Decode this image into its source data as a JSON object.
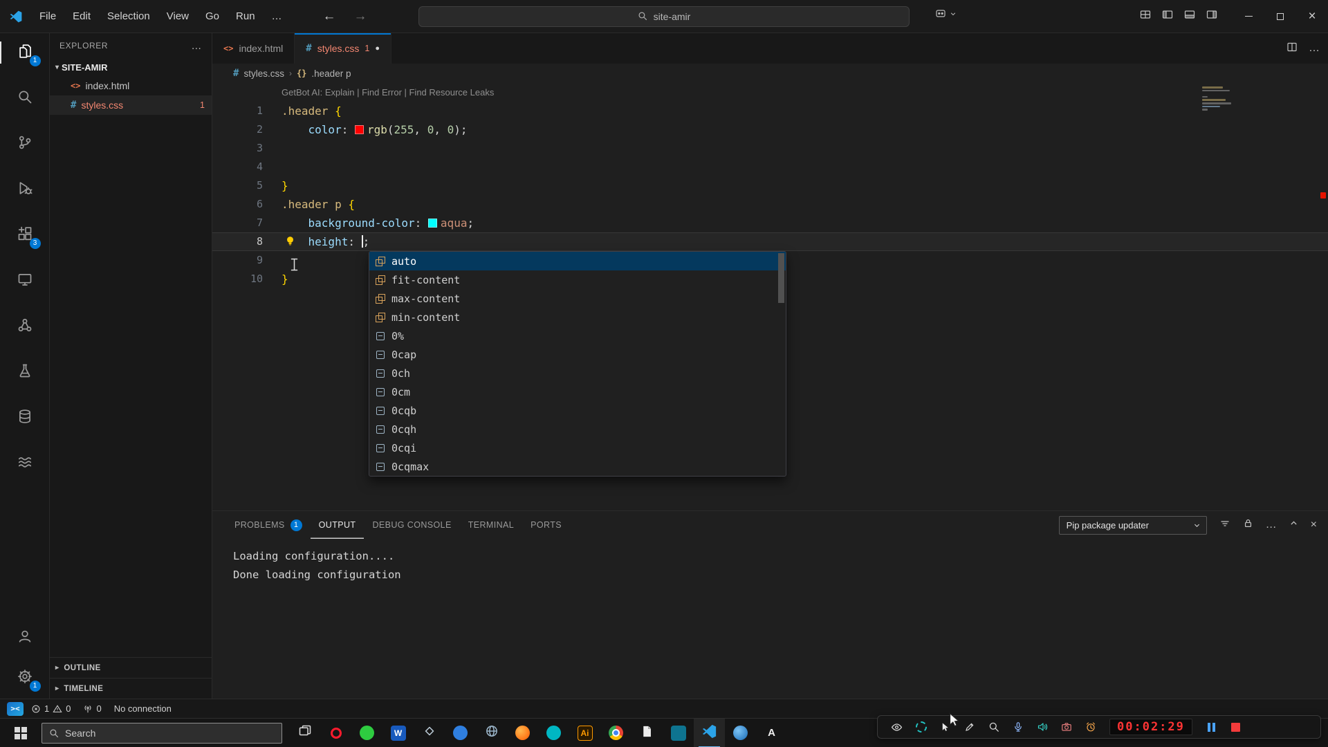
{
  "colors": {
    "accent": "#0078d4",
    "error": "#f14c4c",
    "selection": "#04395e",
    "swatch_red": "#ff0000",
    "swatch_aqua": "#00ffff"
  },
  "title_bar": {
    "menus": [
      "File",
      "Edit",
      "Selection",
      "View",
      "Go",
      "Run"
    ],
    "more_label": "…",
    "search_value": "site-amir"
  },
  "activity_bar": {
    "items": [
      {
        "id": "explorer",
        "active": true,
        "badge": "1"
      },
      {
        "id": "search"
      },
      {
        "id": "source-control"
      },
      {
        "id": "run-debug"
      },
      {
        "id": "extensions",
        "badge": "3"
      },
      {
        "id": "remote-monitor"
      },
      {
        "id": "organization"
      },
      {
        "id": "testing"
      },
      {
        "id": "database"
      },
      {
        "id": "layers"
      }
    ],
    "bottom": [
      {
        "id": "account"
      },
      {
        "id": "settings",
        "badge": "1"
      }
    ]
  },
  "sidebar": {
    "title": "EXPLORER",
    "folder": "SITE-AMIR",
    "files": [
      {
        "name": "index.html",
        "icon": "html"
      },
      {
        "name": "styles.css",
        "icon": "css",
        "active": true,
        "error_badge": "1"
      }
    ],
    "sections": [
      "OUTLINE",
      "TIMELINE"
    ]
  },
  "tabs": [
    {
      "label": "index.html",
      "icon": "html"
    },
    {
      "label": "styles.css",
      "icon": "css",
      "active": true,
      "error_badge": "1",
      "modified": true
    }
  ],
  "breadcrumb": {
    "file": "styles.css",
    "symbol": ".header p"
  },
  "editor": {
    "codelens": "GetBot AI: Explain | Find Error | Find Resource Leaks",
    "lines": [
      {
        "n": "1",
        "tokens": [
          {
            "t": ".header",
            "c": "sel"
          },
          {
            "t": " ",
            "c": "pun"
          },
          {
            "t": "{",
            "c": "brace"
          }
        ]
      },
      {
        "n": "2",
        "tokens": [
          {
            "t": "    ",
            "c": "pun"
          },
          {
            "t": "color",
            "c": "prop"
          },
          {
            "t": ": ",
            "c": "pun"
          },
          {
            "swatch": "#ff0000"
          },
          {
            "t": "rgb",
            "c": "fn"
          },
          {
            "t": "(",
            "c": "pun"
          },
          {
            "t": "255",
            "c": "num"
          },
          {
            "t": ", ",
            "c": "pun"
          },
          {
            "t": "0",
            "c": "num"
          },
          {
            "t": ", ",
            "c": "pun"
          },
          {
            "t": "0",
            "c": "num"
          },
          {
            "t": ")",
            "c": "pun"
          },
          {
            "t": ";",
            "c": "pun"
          }
        ]
      },
      {
        "n": "3",
        "tokens": []
      },
      {
        "n": "4",
        "tokens": []
      },
      {
        "n": "5",
        "tokens": [
          {
            "t": "}",
            "c": "brace"
          }
        ]
      },
      {
        "n": "6",
        "tokens": [
          {
            "t": ".header",
            "c": "sel"
          },
          {
            "t": " ",
            "c": "pun"
          },
          {
            "t": "p",
            "c": "sel"
          },
          {
            "t": " ",
            "c": "pun"
          },
          {
            "t": "{",
            "c": "brace"
          }
        ]
      },
      {
        "n": "7",
        "tokens": [
          {
            "t": "    ",
            "c": "pun"
          },
          {
            "t": "background-color",
            "c": "prop"
          },
          {
            "t": ": ",
            "c": "pun"
          },
          {
            "swatch": "#00ffff"
          },
          {
            "t": "aqua",
            "c": "val"
          },
          {
            "t": ";",
            "c": "pun"
          }
        ]
      },
      {
        "n": "8",
        "current": true,
        "tokens": [
          {
            "t": "    ",
            "c": "pun"
          },
          {
            "t": "height",
            "c": "prop"
          },
          {
            "t": ": ",
            "c": "pun"
          },
          {
            "caret": true
          },
          {
            "t": ";",
            "c": "pun"
          }
        ]
      },
      {
        "n": "9",
        "tokens": []
      },
      {
        "n": "10",
        "tokens": [
          {
            "t": "}",
            "c": "brace"
          }
        ]
      }
    ],
    "suggest": [
      {
        "label": "auto",
        "kind": "value",
        "selected": true
      },
      {
        "label": "fit-content",
        "kind": "value"
      },
      {
        "label": "max-content",
        "kind": "value"
      },
      {
        "label": "min-content",
        "kind": "value"
      },
      {
        "label": "0%",
        "kind": "unit"
      },
      {
        "label": "0cap",
        "kind": "unit"
      },
      {
        "label": "0ch",
        "kind": "unit"
      },
      {
        "label": "0cm",
        "kind": "unit"
      },
      {
        "label": "0cqb",
        "kind": "unit"
      },
      {
        "label": "0cqh",
        "kind": "unit"
      },
      {
        "label": "0cqi",
        "kind": "unit"
      },
      {
        "label": "0cqmax",
        "kind": "unit"
      }
    ]
  },
  "panel": {
    "tabs": [
      {
        "label": "PROBLEMS",
        "badge": "1"
      },
      {
        "label": "OUTPUT",
        "active": true
      },
      {
        "label": "DEBUG CONSOLE"
      },
      {
        "label": "TERMINAL"
      },
      {
        "label": "PORTS"
      }
    ],
    "dropdown_value": "Pip package updater",
    "output_lines": [
      "Loading configuration....",
      "Done loading configuration"
    ]
  },
  "status_bar": {
    "errors": "1",
    "warnings": "0",
    "ports": "0",
    "message": "No connection"
  },
  "taskbar": {
    "search_placeholder": "Search",
    "apps": [
      {
        "id": "task-view"
      },
      {
        "id": "browser-red"
      },
      {
        "id": "app-green"
      },
      {
        "id": "word",
        "letter": "W"
      },
      {
        "id": "app-diamond"
      },
      {
        "id": "app-blue"
      },
      {
        "id": "app-globe"
      },
      {
        "id": "app-orange"
      },
      {
        "id": "app-teal"
      },
      {
        "id": "illustrator",
        "letter": "Ai"
      },
      {
        "id": "chrome"
      },
      {
        "id": "notes"
      },
      {
        "id": "app-teal-square"
      },
      {
        "id": "vscode",
        "active": true
      },
      {
        "id": "browser-blue"
      }
    ],
    "extra_label": "A"
  },
  "recorder": {
    "time": "00:02:29"
  }
}
